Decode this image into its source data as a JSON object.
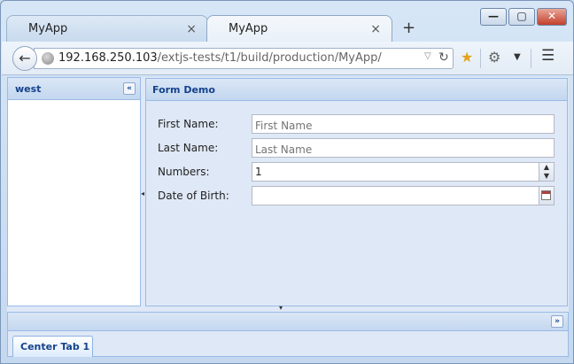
{
  "browser": {
    "tabs": [
      {
        "title": "MyApp",
        "active": false
      },
      {
        "title": "MyApp",
        "active": true
      }
    ],
    "close_glyph": "×",
    "new_tab_glyph": "+",
    "url_host": "192.168.250.103",
    "url_path": "/extjs-tests/t1/build/production/MyApp/",
    "icons": {
      "back": "back-arrow-icon",
      "globe": "globe-icon",
      "reload": "reload-icon",
      "bookmark": "star-icon",
      "tools": "gear-icon",
      "menu": "hamburger-menu-icon"
    }
  },
  "west": {
    "title": "west"
  },
  "form": {
    "title": "Form Demo",
    "fields": [
      {
        "label": "First Name:",
        "value": "",
        "placeholder": "First Name"
      },
      {
        "label": "Last Name:",
        "value": "",
        "placeholder": "Last Name"
      },
      {
        "label": "Numbers:",
        "value": "1",
        "placeholder": ""
      },
      {
        "label": "Date of Birth:",
        "value": "",
        "placeholder": ""
      }
    ]
  },
  "center_tabs": [
    {
      "label": "Center Tab 1",
      "active": true
    }
  ],
  "colors": {
    "header_text": "#15428b",
    "panel_border": "#99bbe8",
    "panel_bg": "#dfe8f6"
  }
}
